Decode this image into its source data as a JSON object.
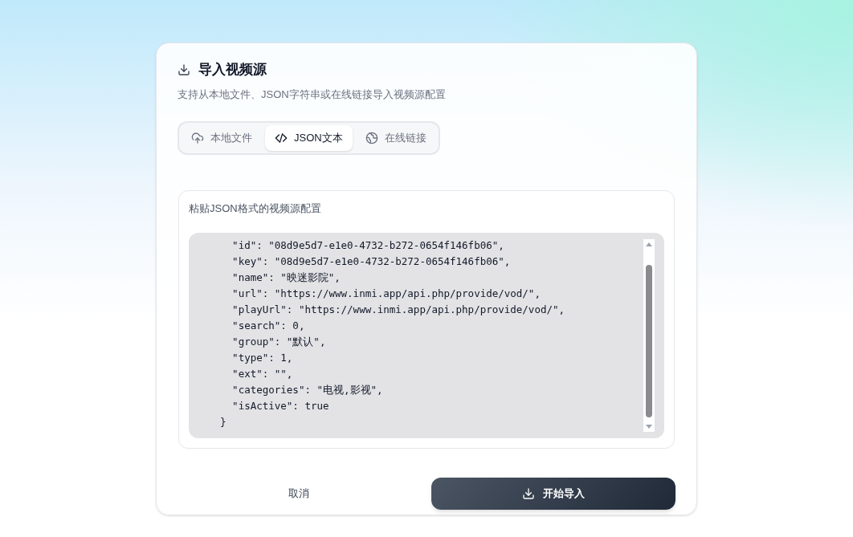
{
  "dialog": {
    "title": "导入视频源",
    "subtitle": "支持从本地文件、JSON字符串或在线链接导入视频源配置"
  },
  "tabs": [
    {
      "kind": "upload",
      "label": "本地文件",
      "selected": false
    },
    {
      "kind": "code",
      "label": "JSON文本",
      "selected": true
    },
    {
      "kind": "globe",
      "label": "在线链接",
      "selected": false
    }
  ],
  "json_panel": {
    "label": "粘贴JSON格式的视频源配置",
    "lines": [
      "    \"id\": \"08d9e5d7-e1e0-4732-b272-0654f146fb06\",",
      "    \"key\": \"08d9e5d7-e1e0-4732-b272-0654f146fb06\",",
      "    \"name\": \"映迷影院\",",
      "    \"url\": \"https://www.inmi.app/api.php/provide/vod/\",",
      "    \"playUrl\": \"https://www.inmi.app/api.php/provide/vod/\",",
      "    \"search\": 0,",
      "    \"group\": \"默认\",",
      "    \"type\": 1,",
      "    \"ext\": \"\",",
      "    \"categories\": \"电视,影视\",",
      "    \"isActive\": true",
      "  }"
    ]
  },
  "buttons": {
    "cancel": "取消",
    "submit": "开始导入"
  }
}
